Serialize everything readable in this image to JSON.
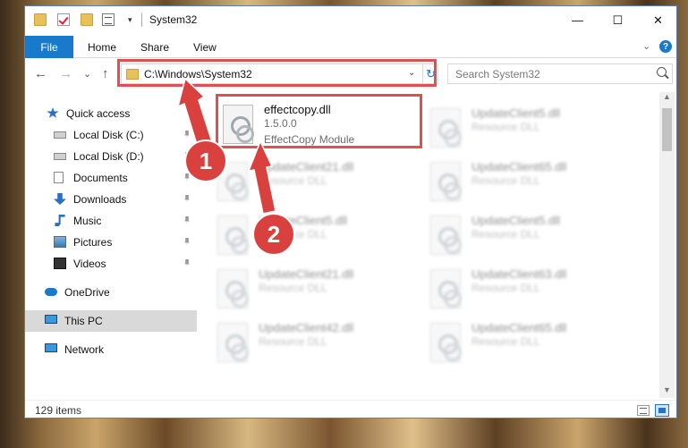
{
  "window": {
    "title": "System32",
    "controls": {
      "minimize": "—",
      "maximize": "☐",
      "close": "✕"
    }
  },
  "quick_access_toolbar": {
    "icons": [
      "folder-icon",
      "check-properties-icon",
      "new-folder-icon",
      "properties-icon"
    ],
    "dropdown": "▾"
  },
  "ribbon": {
    "tabs": [
      {
        "label": "File",
        "active": true
      },
      {
        "label": "Home"
      },
      {
        "label": "Share"
      },
      {
        "label": "View"
      }
    ],
    "expand": "⌄",
    "help": "?"
  },
  "nav": {
    "back": "←",
    "forward": "→",
    "recent": "⌄",
    "up": "↑"
  },
  "address": {
    "path": "C:\\Windows\\System32",
    "dropdown": "⌄",
    "refresh": "↻"
  },
  "search": {
    "placeholder": "Search System32"
  },
  "sidebar": {
    "items": [
      {
        "label": "Quick access",
        "icon": "star-icon",
        "pinned": false
      },
      {
        "label": "Local Disk (C:)",
        "icon": "drive-icon",
        "pinned": true
      },
      {
        "label": "Local Disk (D:)",
        "icon": "drive-icon",
        "pinned": true
      },
      {
        "label": "Documents",
        "icon": "document-icon",
        "pinned": true
      },
      {
        "label": "Downloads",
        "icon": "download-icon",
        "pinned": true
      },
      {
        "label": "Music",
        "icon": "music-icon",
        "pinned": true
      },
      {
        "label": "Pictures",
        "icon": "pictures-icon",
        "pinned": true
      },
      {
        "label": "Videos",
        "icon": "videos-icon",
        "pinned": true
      },
      {
        "label": "OneDrive",
        "icon": "cloud-icon",
        "pinned": false
      },
      {
        "label": "This PC",
        "icon": "computer-icon",
        "pinned": false,
        "selected": true
      },
      {
        "label": "Network",
        "icon": "network-icon",
        "pinned": false
      }
    ]
  },
  "files": {
    "highlighted": {
      "name": "effectcopy.dll",
      "version": "1.5.0.0",
      "description": "EffectCopy Module"
    },
    "left_column": [
      {
        "name": "UpdateClient21.dll",
        "type": "Resource DLL"
      },
      {
        "name": "UpdateClient5.dll",
        "type": "Resource DLL"
      },
      {
        "name": "UpdateClient21.dll",
        "type": "Resource DLL"
      },
      {
        "name": "UpdateClient42.dll",
        "type": "Resource DLL"
      }
    ],
    "right_column": [
      {
        "name": "UpdateClient5.dll",
        "type": "Resource DLL"
      },
      {
        "name": "UpdateClient65.dll",
        "type": "Resource DLL"
      },
      {
        "name": "UpdateClient5.dll",
        "type": "Resource DLL"
      },
      {
        "name": "UpdateClient63.dll",
        "type": "Resource DLL"
      },
      {
        "name": "UpdateClient65.dll",
        "type": "Resource DLL"
      }
    ]
  },
  "scrollbar": {
    "up": "▲",
    "down": "▼"
  },
  "status": {
    "count": "129 items"
  },
  "annotations": {
    "markers": [
      "1",
      "2"
    ],
    "color": "#e05050"
  }
}
